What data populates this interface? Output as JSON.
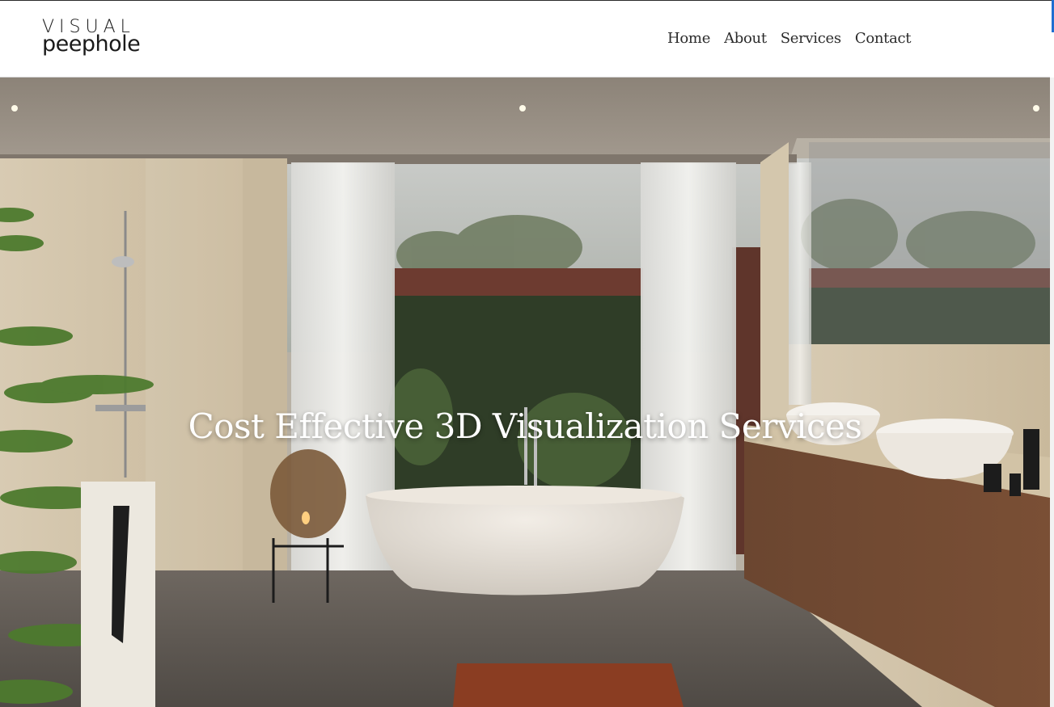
{
  "brand": {
    "line1": "VISUAL",
    "line2": "peephole"
  },
  "nav": {
    "items": [
      "Home",
      "About",
      "Services",
      "Contact"
    ]
  },
  "hero": {
    "title": "Cost Effective 3D Visualization Services",
    "image": "bathroom-interior-render"
  },
  "colors": {
    "accent": "#1f6fd1",
    "header_bg": "#ffffff",
    "nav_text": "#2b2b2b",
    "hero_title": "#ffffff"
  }
}
